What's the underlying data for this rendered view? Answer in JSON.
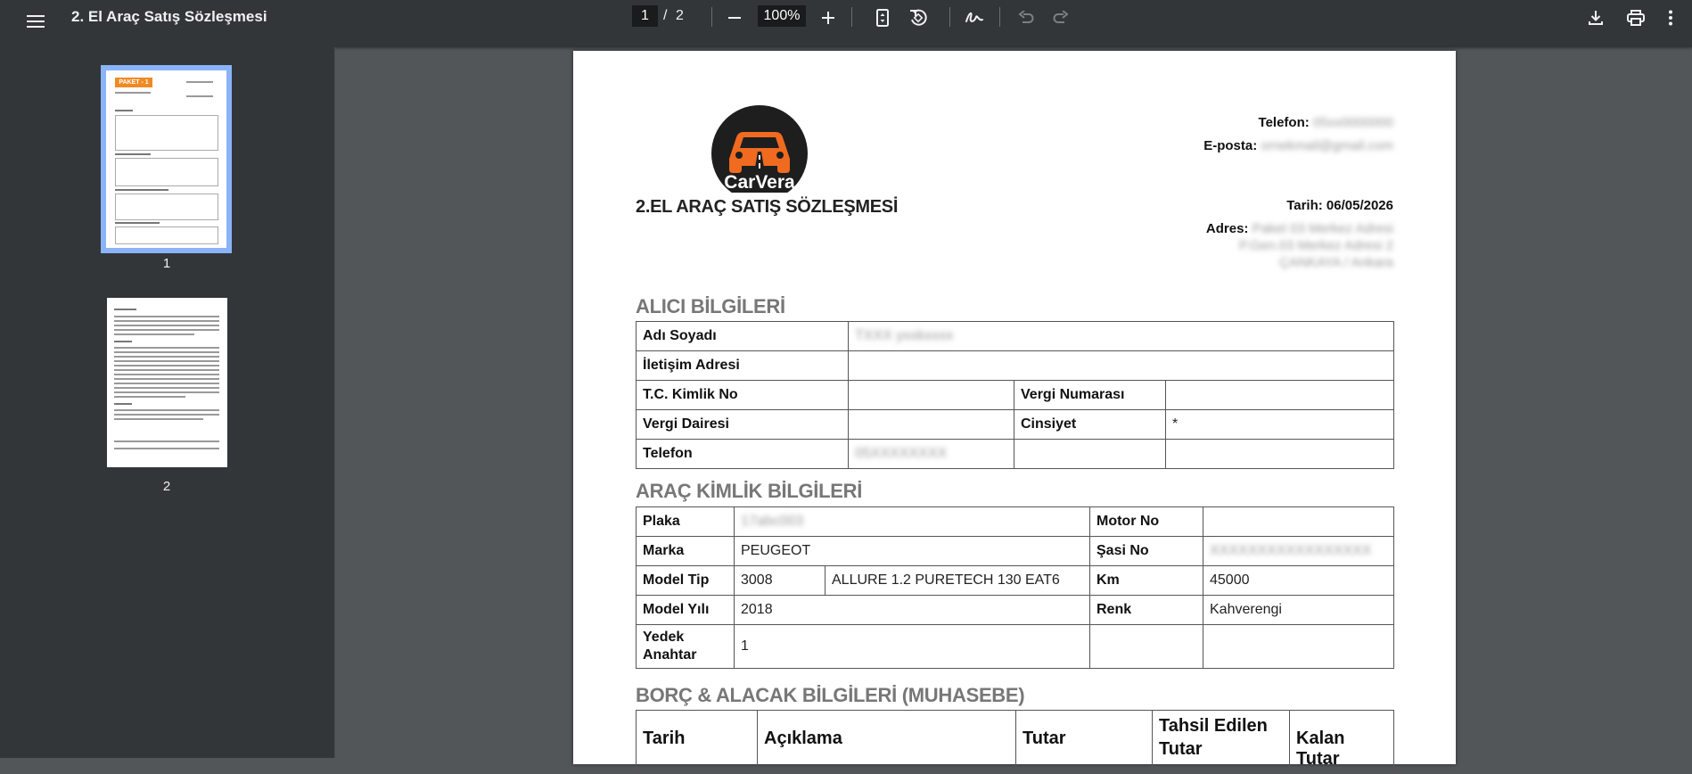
{
  "toolbar": {
    "title": "2. El Araç Satış Sözleşmesi",
    "current_page": "1",
    "separator": "/",
    "total_pages": "2",
    "zoom": "100%"
  },
  "sidebar": {
    "thumbnails": [
      {
        "label": "1",
        "badge": "PAKET - 1"
      },
      {
        "label": "2"
      }
    ]
  },
  "document": {
    "logo_text": "CarVera",
    "contract_title": "2.EL ARAÇ SATIŞ SÖZLEŞMESİ",
    "phone_label": "Telefon:",
    "phone_value": "05xx0000000",
    "email_label": "E-posta:",
    "email_value": "ornekmail@gmail.com",
    "date_label": "Tarih:",
    "date_value": "06/05/2026",
    "address_label": "Adres:",
    "address_line1": "Paket 03 Merkez Adresi",
    "address_line2": "P.Gen.03 Merkez Adresi 2",
    "address_line3": "ÇANKAYA / Ankara",
    "buyer": {
      "section_title": "ALICI BİLGİLERİ",
      "name_label": "Adı Soyadı",
      "name_value": "TXXX yxxkxxxx",
      "address_label": "İletişim Adresi",
      "tc_label": "T.C. Kimlik No",
      "tax_no_label": "Vergi Numarası",
      "tax_office_label": "Vergi Dairesi",
      "gender_label": "Cinsiyet",
      "gender_value": "*",
      "phone_label": "Telefon",
      "phone_value": "05XXXXXXXX"
    },
    "vehicle": {
      "section_title": "ARAÇ KİMLİK BİLGİLERİ",
      "plate_label": "Plaka",
      "plate_value": "17abc003",
      "engine_label": "Motor No",
      "brand_label": "Marka",
      "brand_value": "PEUGEOT",
      "chassis_label": "Şasi No",
      "chassis_value": "XXXXXXXXXXXXXXXXX",
      "model_label": "Model Tip",
      "model_value": "3008",
      "model_detail": "ALLURE 1.2 PURETECH 130 EAT6",
      "km_label": "Km",
      "km_value": "45000",
      "year_label": "Model Yılı",
      "year_value": "2018",
      "color_label": "Renk",
      "color_value": "Kahverengi",
      "spare_key_label_1": "Yedek",
      "spare_key_label_2": "Anahtar",
      "spare_key_value": "1"
    },
    "debt": {
      "section_title": "BORÇ & ALACAK BİLGİLERİ (MUHASEBE)",
      "headers": [
        "Tarih",
        "Açıklama",
        "Tutar",
        "Tahsil Edilen Tutar",
        "Kalan Tutar"
      ]
    }
  },
  "colors": {
    "toolbar_bg": "#323639",
    "viewer_bg": "#525659",
    "thumb_selected": "#8ab4f8",
    "logo_orange": "#f06a1f"
  },
  "icons": [
    "menu-icon",
    "zoom-out-icon",
    "zoom-in-icon",
    "fit-page-icon",
    "rotate-icon",
    "draw-icon",
    "undo-icon",
    "redo-icon",
    "download-icon",
    "print-icon",
    "more-vert-icon"
  ]
}
